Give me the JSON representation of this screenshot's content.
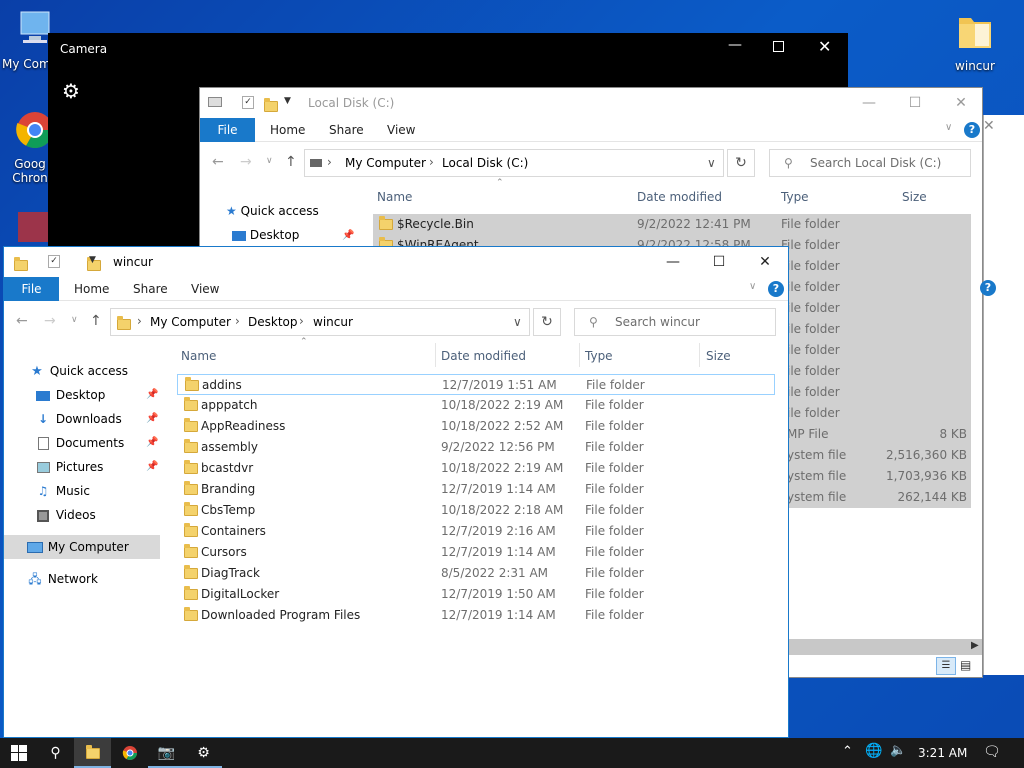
{
  "desktop": {
    "icons": [
      {
        "label": "My Com"
      },
      {
        "label": "Goog Chron"
      },
      {
        "label": "wincur"
      }
    ]
  },
  "camera": {
    "title": "Camera"
  },
  "explorer_back": {
    "title": "Local Disk (C:)",
    "ribbon": [
      "File",
      "Home",
      "Share",
      "View"
    ],
    "breadcrumb": [
      "My Computer",
      "Local Disk (C:)"
    ],
    "search_placeholder": "Search Local Disk (C:)",
    "columns": [
      "Name",
      "Date modified",
      "Type",
      "Size"
    ],
    "nav": [
      {
        "label": "Quick access"
      },
      {
        "label": "Desktop"
      }
    ],
    "rows": [
      {
        "name": "$Recycle.Bin",
        "date": "9/2/2022 12:41 PM",
        "type": "File folder",
        "size": ""
      },
      {
        "name": "$WinREAgent",
        "date": "9/2/2022 12:58 PM",
        "type": "File folder",
        "size": ""
      },
      {
        "name": "",
        "date": "",
        "type": "ile folder",
        "size": ""
      },
      {
        "name": "",
        "date": "",
        "type": "ile folder",
        "size": ""
      },
      {
        "name": "",
        "date": "",
        "type": "ile folder",
        "size": ""
      },
      {
        "name": "",
        "date": "",
        "type": "ile folder",
        "size": ""
      },
      {
        "name": "",
        "date": "",
        "type": "ile folder",
        "size": ""
      },
      {
        "name": "",
        "date": "",
        "type": "ile folder",
        "size": ""
      },
      {
        "name": "",
        "date": "",
        "type": "ile folder",
        "size": ""
      },
      {
        "name": "",
        "date": "",
        "type": "ile folder",
        "size": ""
      },
      {
        "name": "",
        "date": "",
        "type": "MP File",
        "size": "8 KB"
      },
      {
        "name": "",
        "date": "",
        "type": "ystem file",
        "size": "2,516,360 KB"
      },
      {
        "name": "",
        "date": "",
        "type": "ystem file",
        "size": "1,703,936 KB"
      },
      {
        "name": "",
        "date": "",
        "type": "ystem file",
        "size": "262,144 KB"
      }
    ]
  },
  "explorer_front": {
    "title": "wincur",
    "ribbon": [
      "File",
      "Home",
      "Share",
      "View"
    ],
    "breadcrumb": [
      "My Computer",
      "Desktop",
      "wincur"
    ],
    "search_placeholder": "Search wincur",
    "columns": [
      "Name",
      "Date modified",
      "Type",
      "Size"
    ],
    "nav": [
      {
        "label": "Quick access",
        "icon": "star-icon",
        "pinned": false
      },
      {
        "label": "Desktop",
        "icon": "desktop-icon",
        "pinned": true
      },
      {
        "label": "Downloads",
        "icon": "download-icon",
        "pinned": true
      },
      {
        "label": "Documents",
        "icon": "document-icon",
        "pinned": true
      },
      {
        "label": "Pictures",
        "icon": "picture-icon",
        "pinned": true
      },
      {
        "label": "Music",
        "icon": "music-icon",
        "pinned": false
      },
      {
        "label": "Videos",
        "icon": "video-icon",
        "pinned": false
      },
      {
        "label": "My Computer",
        "icon": "computer-icon",
        "pinned": false
      },
      {
        "label": "Network",
        "icon": "network-icon",
        "pinned": false
      }
    ],
    "rows": [
      {
        "name": "addins",
        "date": "12/7/2019 1:51 AM",
        "type": "File folder",
        "size": ""
      },
      {
        "name": "apppatch",
        "date": "10/18/2022 2:19 AM",
        "type": "File folder",
        "size": ""
      },
      {
        "name": "AppReadiness",
        "date": "10/18/2022 2:52 AM",
        "type": "File folder",
        "size": ""
      },
      {
        "name": "assembly",
        "date": "9/2/2022 12:56 PM",
        "type": "File folder",
        "size": ""
      },
      {
        "name": "bcastdvr",
        "date": "10/18/2022 2:19 AM",
        "type": "File folder",
        "size": ""
      },
      {
        "name": "Branding",
        "date": "12/7/2019 1:14 AM",
        "type": "File folder",
        "size": ""
      },
      {
        "name": "CbsTemp",
        "date": "10/18/2022 2:18 AM",
        "type": "File folder",
        "size": ""
      },
      {
        "name": "Containers",
        "date": "12/7/2019 2:16 AM",
        "type": "File folder",
        "size": ""
      },
      {
        "name": "Cursors",
        "date": "12/7/2019 1:14 AM",
        "type": "File folder",
        "size": ""
      },
      {
        "name": "DiagTrack",
        "date": "8/5/2022 2:31 AM",
        "type": "File folder",
        "size": ""
      },
      {
        "name": "DigitalLocker",
        "date": "12/7/2019 1:50 AM",
        "type": "File folder",
        "size": ""
      },
      {
        "name": "Downloaded Program Files",
        "date": "12/7/2019 1:14 AM",
        "type": "File folder",
        "size": ""
      }
    ]
  },
  "taskbar": {
    "clock": "3:21 AM",
    "colors": {
      "bg": "#1a1a1a",
      "accent": "#1979ca"
    }
  }
}
